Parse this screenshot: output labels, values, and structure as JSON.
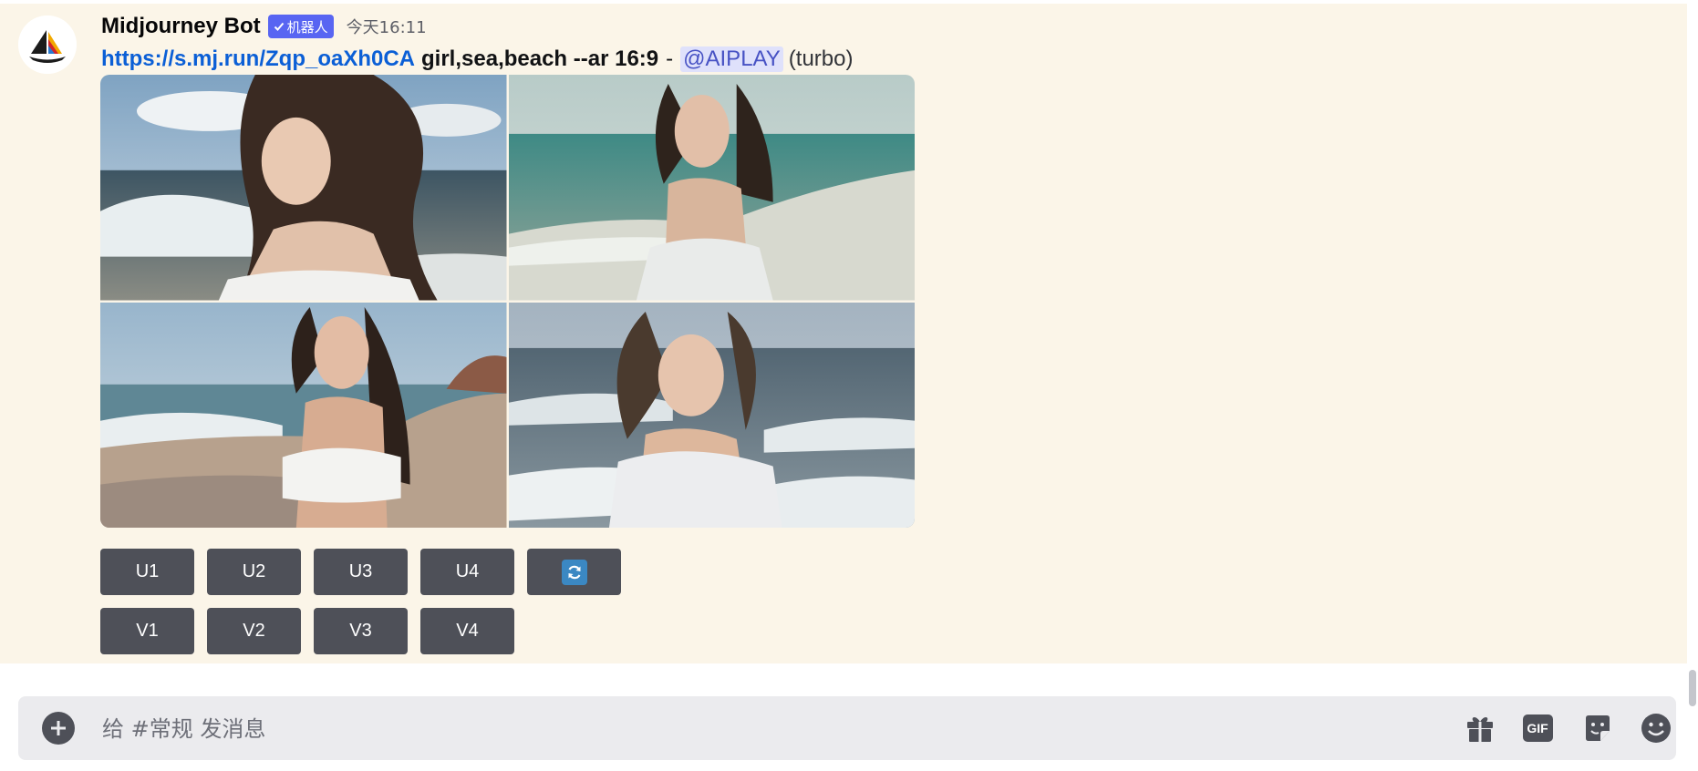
{
  "message": {
    "username": "Midjourney Bot",
    "bot_tag": "机器人",
    "timestamp": "今天16:11",
    "link": "https://s.mj.run/Zqp_oaXh0CA",
    "prompt": "girl,sea,beach --ar 16:9",
    "separator": "-",
    "mention": "@AIPLAY",
    "speed": "(turbo)"
  },
  "grid": {
    "images": [
      "girl-on-beach-1",
      "girl-on-beach-2",
      "girl-on-beach-3",
      "girl-on-beach-4"
    ]
  },
  "buttons": {
    "upscale": [
      "U1",
      "U2",
      "U3",
      "U4"
    ],
    "variation": [
      "V1",
      "V2",
      "V3",
      "V4"
    ],
    "reroll_icon": "reroll-icon"
  },
  "composer": {
    "placeholder": "给 #常规 发消息",
    "icons": [
      "add-icon",
      "gift-icon",
      "gif-icon",
      "sticker-icon",
      "emoji-icon"
    ],
    "gif_label": "GIF"
  },
  "colors": {
    "message_bg": "#fbf5e8",
    "button_bg": "#4e5058",
    "link": "#0b5fd6",
    "mention_bg": "#dfe1fb",
    "bot_tag": "#5865f2",
    "reroll_accent": "#3b88c3"
  }
}
